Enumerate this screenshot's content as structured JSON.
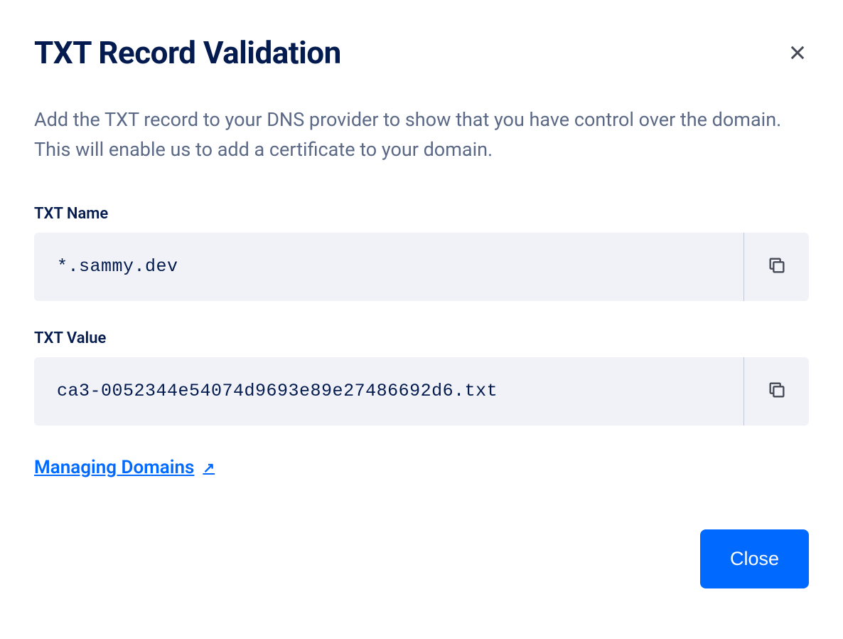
{
  "dialog": {
    "title": "TXT Record Validation",
    "description": "Add the TXT record to your DNS provider to show that you have control over the domain. This will enable us to add a certificate to your domain.",
    "fields": {
      "txt_name": {
        "label": "TXT Name",
        "value": "*.sammy.dev"
      },
      "txt_value": {
        "label": "TXT Value",
        "value": "ca3-0052344e54074d9693e89e27486692d6.txt"
      }
    },
    "link": {
      "text": "Managing Domains"
    },
    "close_button": "Close"
  }
}
